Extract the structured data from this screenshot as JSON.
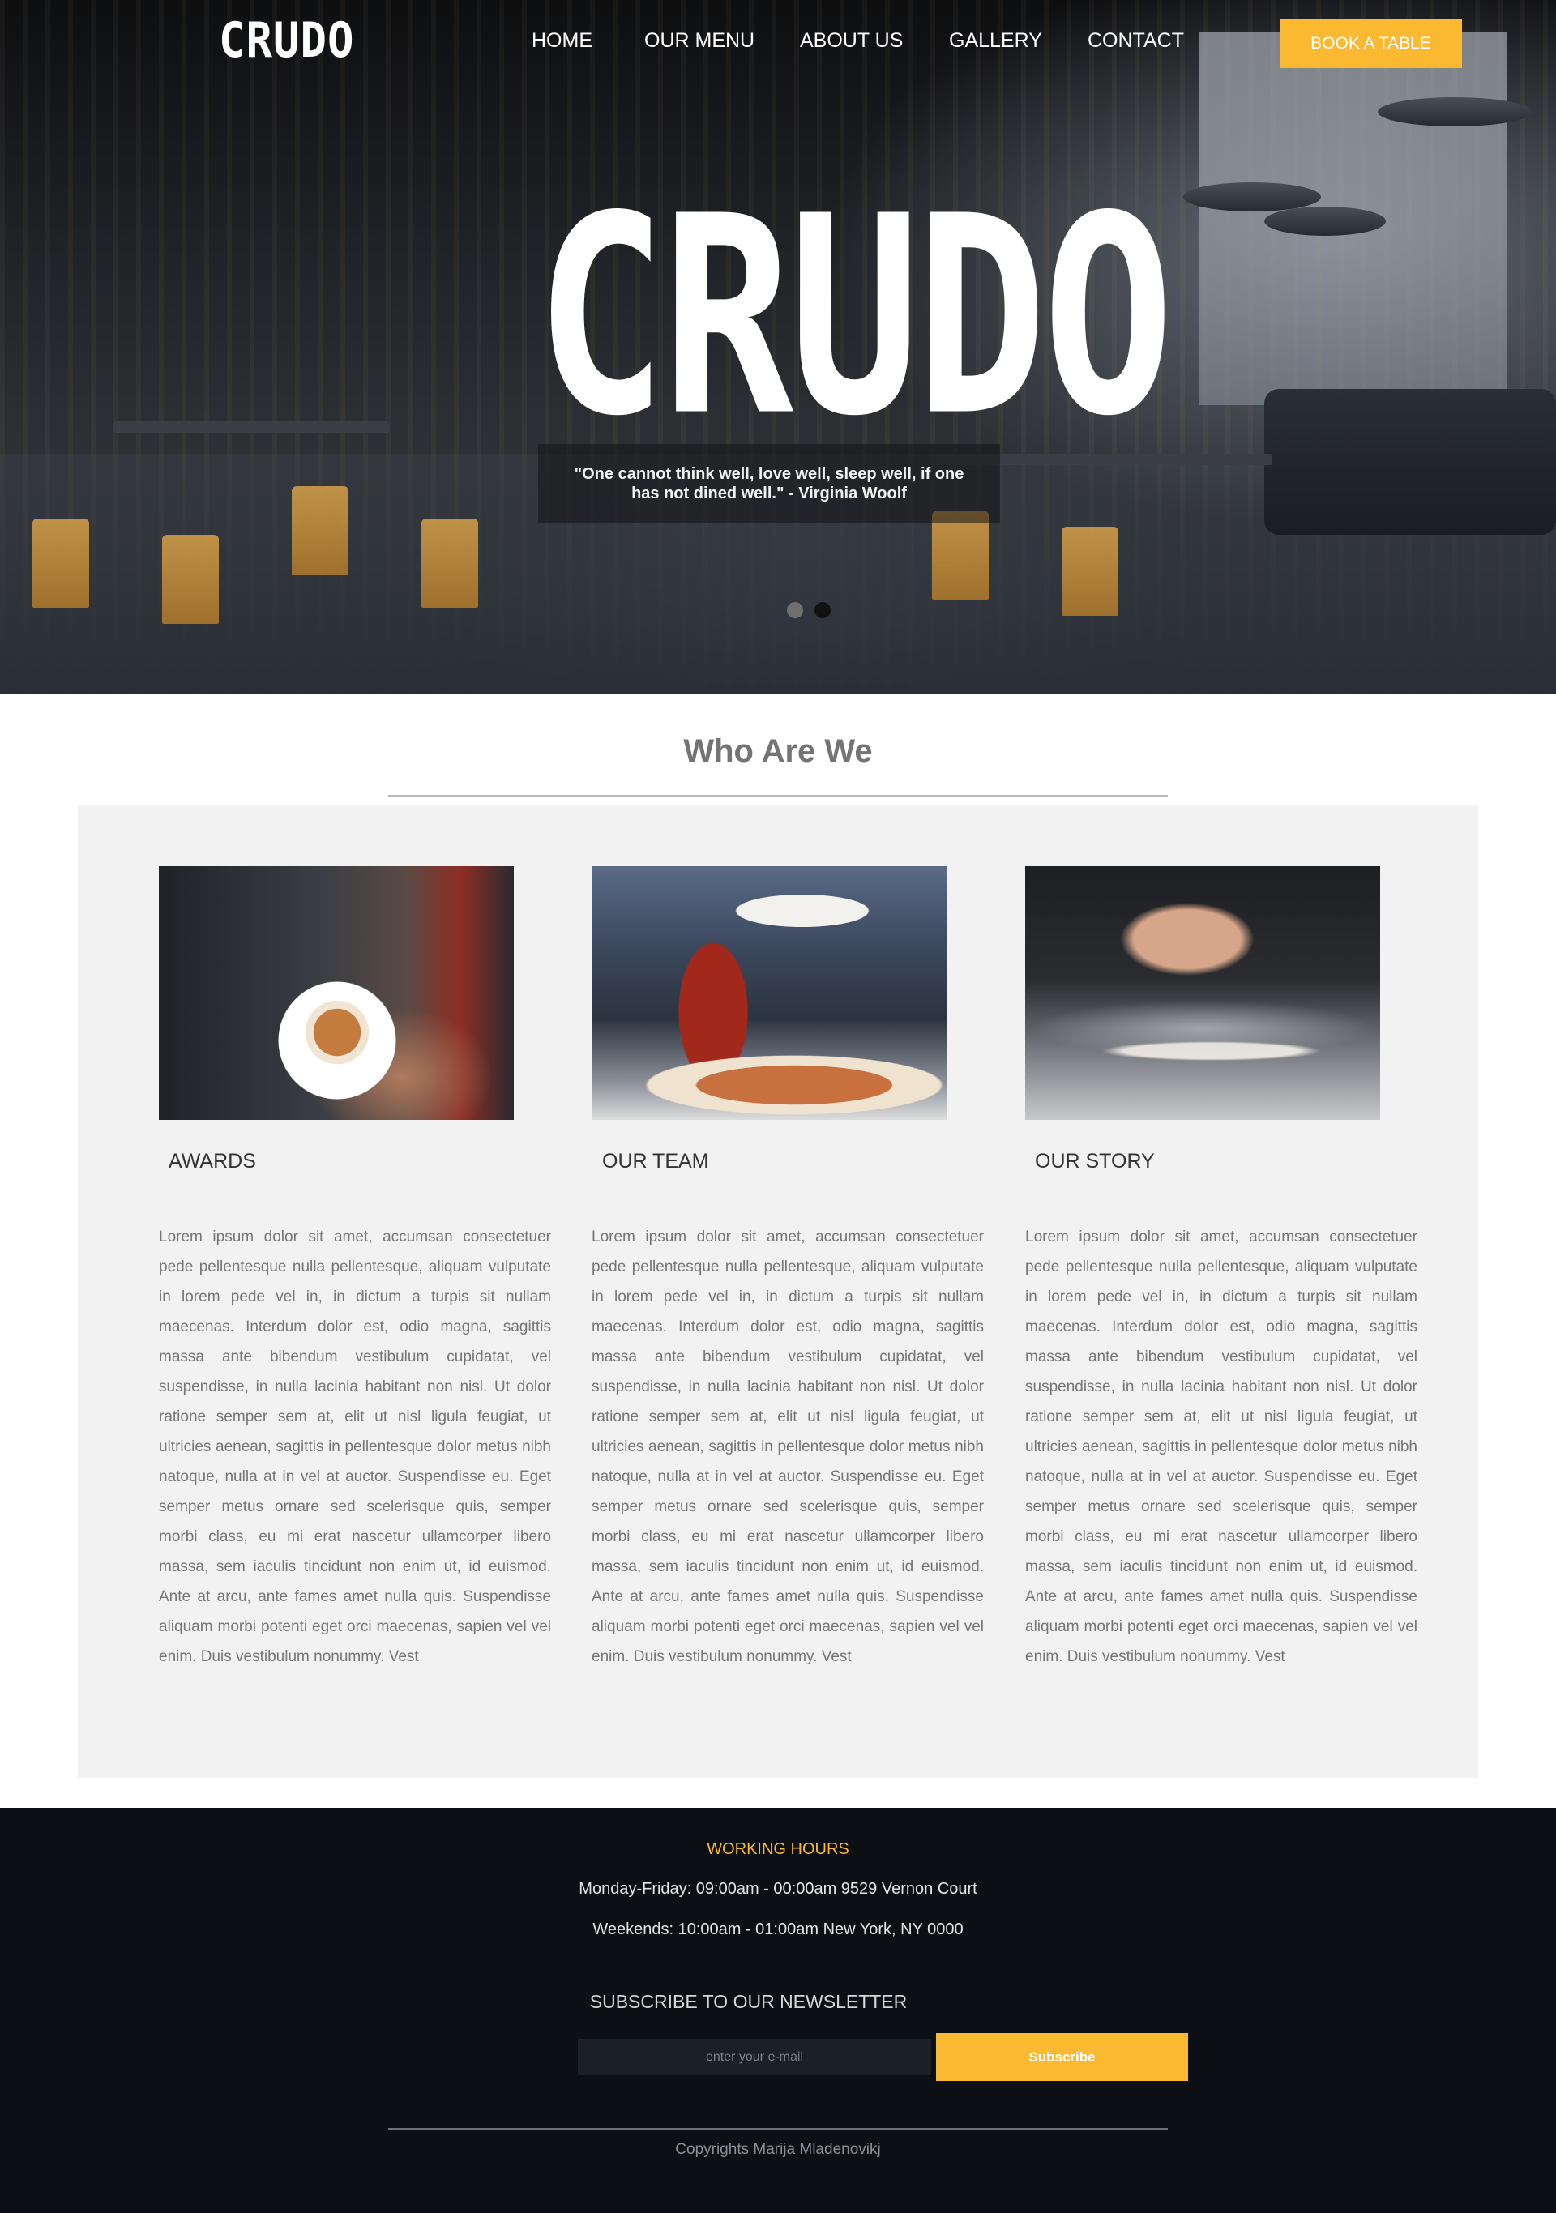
{
  "header": {
    "logo": "CRUDO",
    "nav": [
      {
        "label": "HOME"
      },
      {
        "label": "OUR MENU"
      },
      {
        "label": "ABOUT US"
      },
      {
        "label": "GALLERY"
      },
      {
        "label": "CONTACT"
      }
    ],
    "cta_label": "BOOK A TABLE",
    "accent_color": "#fbb931"
  },
  "hero": {
    "logo": "CRUDO",
    "quote": "\"One cannot think well, love well, sleep well, if one has not dined well.\" - Virginia Woolf",
    "slides": 2,
    "active_slide": 2
  },
  "about": {
    "title": "Who Are We",
    "cards": [
      {
        "title": "AWARDS",
        "image": "latte-art-photo",
        "text": "Lorem ipsum dolor sit amet, accumsan consectetuer pede pellentesque nulla pellentesque, aliquam vulputate in lorem pede vel in, in dictum a turpis sit nullam maecenas. Interdum dolor est, odio magna, sagittis massa ante bibendum vestibulum cupidatat, vel suspendisse, in nulla lacinia habitant non nisl. Ut dolor ratione semper sem at, elit ut nisl ligula feugiat, ut ultricies aenean, sagittis in pellentesque dolor metus nibh natoque, nulla at in vel at auctor. Suspendisse eu. Eget semper metus ornare sed scelerisque quis, semper morbi class, eu mi erat nascetur ullamcorper libero massa, sem iaculis tincidunt non enim ut, id euismod. Ante at arcu, ante fames amet nulla quis. Suspendisse aliquam morbi potenti eget orci maecenas, sapien vel vel enim. Duis vestibulum nonummy. Vest"
      },
      {
        "title": "OUR TEAM",
        "image": "pizza-chef-photo",
        "text": "Lorem ipsum dolor sit amet, accumsan consectetuer pede pellentesque nulla pellentesque, aliquam vulputate in lorem pede vel in, in dictum a turpis sit nullam maecenas. Interdum dolor est, odio magna, sagittis massa ante bibendum vestibulum cupidatat, vel suspendisse, in nulla lacinia habitant non nisl. Ut dolor ratione semper sem at, elit ut nisl ligula feugiat, ut ultricies aenean, sagittis in pellentesque dolor metus nibh natoque, nulla at in vel at auctor. Suspendisse eu. Eget semper metus ornare sed scelerisque quis, semper morbi class, eu mi erat nascetur ullamcorper libero massa, sem iaculis tincidunt non enim ut, id euismod. Ante at arcu, ante fames amet nulla quis. Suspendisse aliquam morbi potenti eget orci maecenas, sapien vel vel enim. Duis vestibulum nonummy. Vest"
      },
      {
        "title": "OUR STORY",
        "image": "flour-hands-photo",
        "text": "Lorem ipsum dolor sit amet, accumsan consectetuer pede pellentesque nulla pellentesque, aliquam vulputate in lorem pede vel in, in dictum a turpis sit nullam maecenas. Interdum dolor est, odio magna, sagittis massa ante bibendum vestibulum cupidatat, vel suspendisse, in nulla lacinia habitant non nisl. Ut dolor ratione semper sem at, elit ut nisl ligula feugiat, ut ultricies aenean, sagittis in pellentesque dolor metus nibh natoque, nulla at in vel at auctor. Suspendisse eu. Eget semper metus ornare sed scelerisque quis, semper morbi class, eu mi erat nascetur ullamcorper libero massa, sem iaculis tincidunt non enim ut, id euismod. Ante at arcu, ante fames amet nulla quis. Suspendisse aliquam morbi potenti eget orci maecenas, sapien vel vel enim. Duis vestibulum nonummy. Vest"
      }
    ]
  },
  "footer": {
    "hours_title": "WORKING HOURS",
    "hours_weekdays": "Monday-Friday: 09:00am - 00:00am 9529 Vernon Court",
    "hours_weekends": "Weekends: 10:00am - 01:00am New York, NY 0000",
    "newsletter_title": "SUBSCRIBE TO OUR NEWSLETTER",
    "email_placeholder": "enter your e-mail",
    "subscribe_label": "Subscribe",
    "copyright": "Copyrights Marija Mladenovikj"
  }
}
